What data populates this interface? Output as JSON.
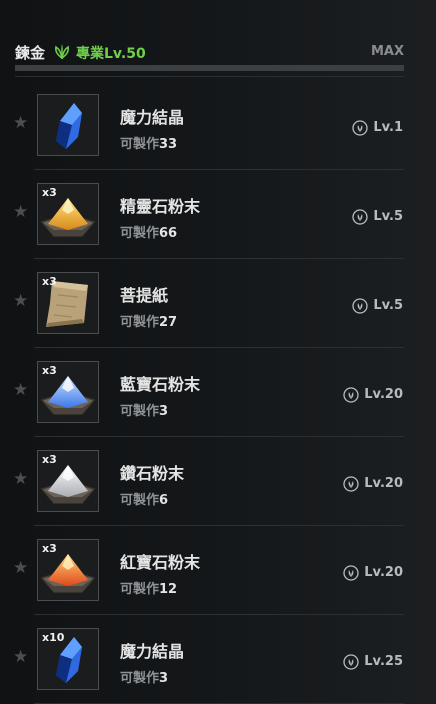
{
  "header": {
    "skill_name": "鍊金",
    "proficiency": "專業Lv.50",
    "max_label": "MAX",
    "accent_color": "#6fcf4a"
  },
  "craft_prefix": "可製作",
  "items": [
    {
      "name": "魔力結晶",
      "qty": "",
      "count": "33",
      "level": "Lv.1",
      "icon": "blue-crystal-icon"
    },
    {
      "name": "精靈石粉末",
      "qty": "x3",
      "count": "66",
      "level": "Lv.5",
      "icon": "gold-powder-icon"
    },
    {
      "name": "菩提紙",
      "qty": "x3",
      "count": "27",
      "level": "Lv.5",
      "icon": "paper-scroll-icon"
    },
    {
      "name": "藍寶石粉末",
      "qty": "x3",
      "count": "3",
      "level": "Lv.20",
      "icon": "blue-powder-icon"
    },
    {
      "name": "鑽石粉末",
      "qty": "x3",
      "count": "6",
      "level": "Lv.20",
      "icon": "white-powder-icon"
    },
    {
      "name": "紅寶石粉末",
      "qty": "x3",
      "count": "12",
      "level": "Lv.20",
      "icon": "red-powder-icon"
    },
    {
      "name": "魔力結晶",
      "qty": "x10",
      "count": "3",
      "level": "Lv.25",
      "icon": "blue-crystal-icon"
    }
  ]
}
